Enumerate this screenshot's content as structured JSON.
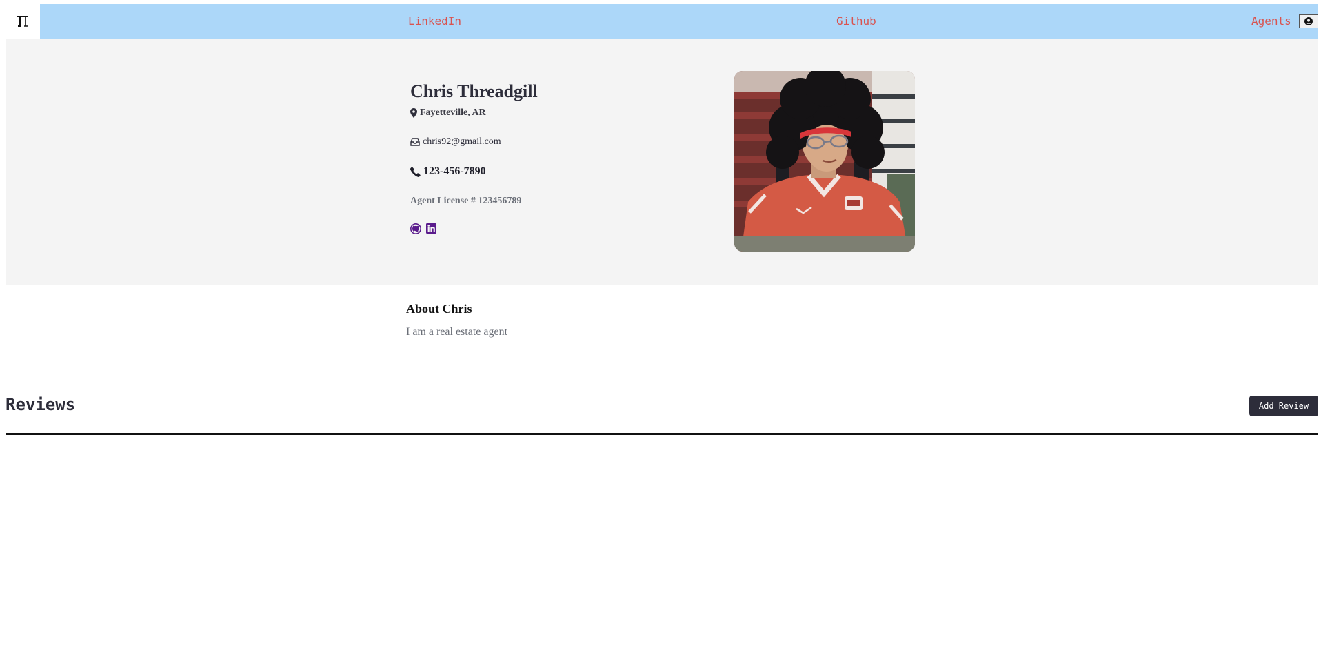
{
  "nav": {
    "logo_icon": "house-logo-icon",
    "links": [
      {
        "label": "LinkedIn"
      },
      {
        "label": "Github"
      },
      {
        "label": "Agents"
      }
    ],
    "user_icon": "user-circle-icon"
  },
  "profile": {
    "name": "Chris Threadgill",
    "location": "Fayetteville, AR",
    "email": "chris92@gmail.com",
    "phone": "123-456-7890",
    "license": "Agent License # 123456789",
    "icons": {
      "location": "map-marker-icon",
      "email": "inbox-icon",
      "phone": "phone-icon",
      "github": "github-icon",
      "linkedin": "linkedin-icon"
    },
    "photo_alt": "Agent profile photo"
  },
  "about": {
    "title": "About Chris",
    "text": "I am a real estate agent"
  },
  "reviews": {
    "title": "Reviews",
    "add_button_label": "Add Review"
  },
  "colors": {
    "nav_bg": "#acd7f9",
    "nav_link": "#d9534f",
    "hero_bg": "#f4f4f4",
    "dark_text": "#2d2d3a",
    "button_bg": "#2d2d3a",
    "social_icon": "#5a1b8c"
  }
}
